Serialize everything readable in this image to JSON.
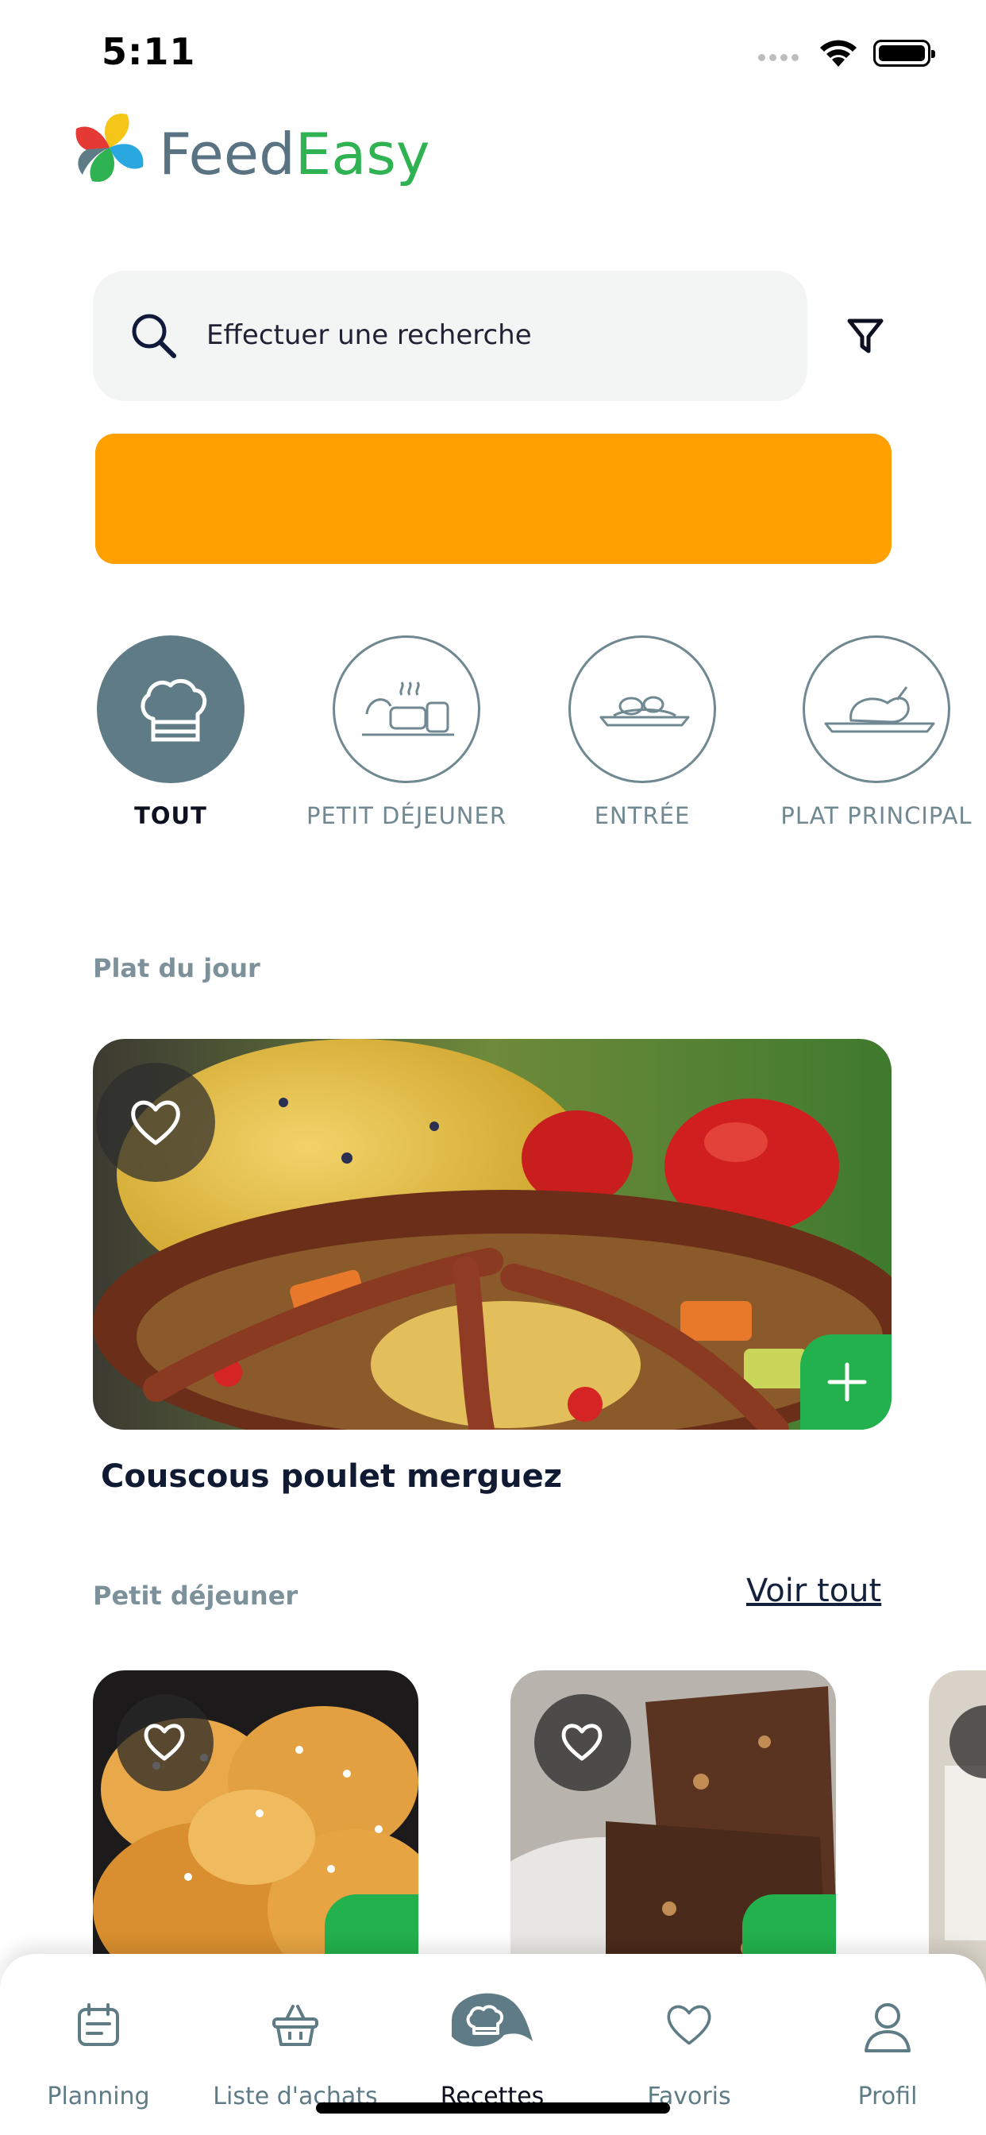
{
  "status_bar": {
    "time": "5:11"
  },
  "brand": {
    "name_part1": "Feed",
    "name_part2": "Easy"
  },
  "search": {
    "placeholder": "Effectuer une recherche"
  },
  "categories": [
    {
      "label": "TOUT",
      "active": true
    },
    {
      "label": "PETIT DÉJEUNER",
      "active": false
    },
    {
      "label": "ENTRÉE",
      "active": false
    },
    {
      "label": "PLAT PRINCIPAL",
      "active": false
    }
  ],
  "daily": {
    "section_title": "Plat du jour",
    "recipe_title": "Couscous poulet merguez"
  },
  "breakfast": {
    "section_title": "Petit déjeuner",
    "see_all": "Voir tout"
  },
  "nav": [
    {
      "label": "Planning",
      "icon": "calendar-icon"
    },
    {
      "label": "Liste d'achats",
      "icon": "basket-icon"
    },
    {
      "label": "Recettes",
      "icon": "chef-hat-icon",
      "active": true
    },
    {
      "label": "Favoris",
      "icon": "heart-icon"
    },
    {
      "label": "Profil",
      "icon": "user-icon"
    }
  ],
  "colors": {
    "brand_green": "#2fb251",
    "brand_slate": "#5f7c86",
    "banner_orange": "#ffa000",
    "add_button": "#23b14d"
  }
}
